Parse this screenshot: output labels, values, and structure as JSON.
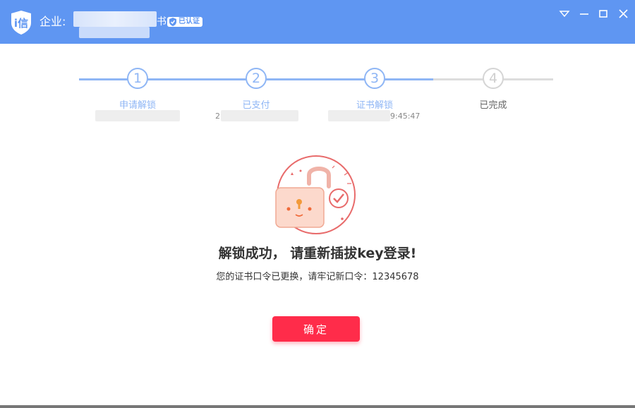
{
  "window": {
    "company_label": "企业:",
    "company_suffix": "书",
    "verified_badge": "已认证",
    "controls": [
      "dropdown-icon",
      "minimize-icon",
      "maximize-icon",
      "close-icon"
    ],
    "brand_color": "#5f96f2"
  },
  "steps": [
    {
      "number": "1",
      "label": "申请解锁",
      "state": "done"
    },
    {
      "number": "2",
      "label": "已支付",
      "time_prefix": "2",
      "state": "done"
    },
    {
      "number": "3",
      "label": "证书解锁",
      "time_suffix": "9:45:47",
      "state": "done"
    },
    {
      "number": "4",
      "label": "已完成",
      "state": "todo"
    }
  ],
  "result": {
    "title": "解锁成功， 请重新插拔key登录!",
    "subtitle": "您的证书口令已更换，请牢记新口令：12345678"
  },
  "actions": {
    "confirm_label": "确定",
    "confirm_color": "#ff2c4a"
  }
}
